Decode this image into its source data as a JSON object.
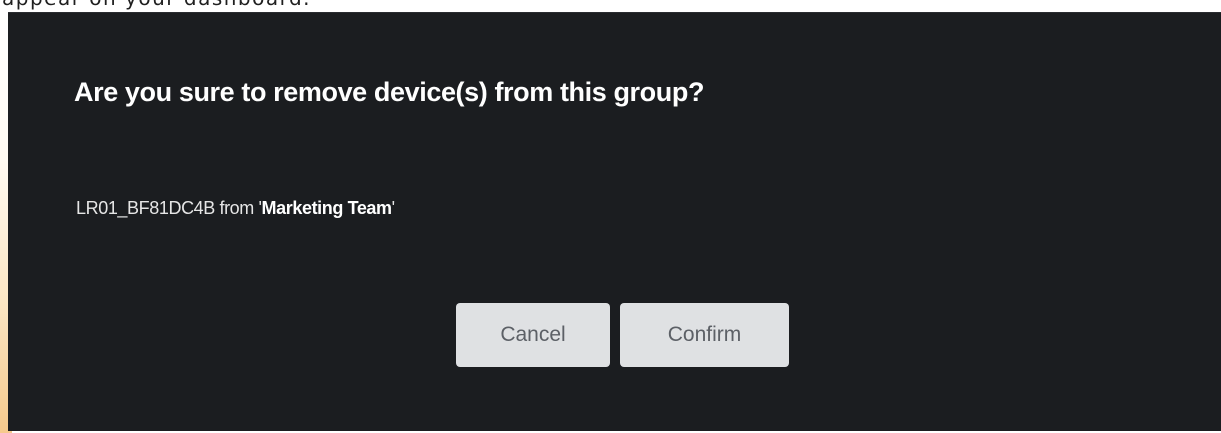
{
  "background": {
    "partial_text": "appear on your dashboard."
  },
  "dialog": {
    "title": "Are you sure to remove device(s) from this group?",
    "message": {
      "device_name": "LR01_BF81DC4B",
      "connector": " from ",
      "quote_open": "'",
      "group_name": "Marketing Team",
      "quote_close": "'"
    },
    "buttons": {
      "cancel_label": "Cancel",
      "confirm_label": "Confirm"
    }
  },
  "colors": {
    "dialog_background": "#1b1d20",
    "title_text": "#ffffff",
    "message_text": "#e6e6e6",
    "button_background": "#dfe1e3",
    "button_text": "#5c6066"
  }
}
